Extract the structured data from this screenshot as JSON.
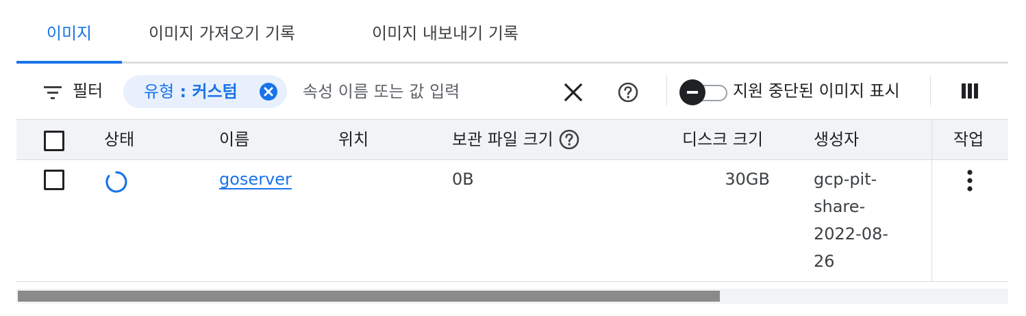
{
  "tabs": [
    {
      "label": "이미지",
      "active": true
    },
    {
      "label": "이미지 가져오기 기록",
      "active": false
    },
    {
      "label": "이미지 내보내기 기록",
      "active": false
    }
  ],
  "filterbar": {
    "filter_label": "필터",
    "chip": {
      "key": "유형",
      "separator": " : ",
      "value": "커스텀"
    },
    "input_placeholder": "속성 이름 또는 값 입력",
    "input_value": "",
    "toggle_label": "지원 중단된 이미지 표시",
    "icons": [
      "filter-icon",
      "chip-close-icon",
      "clear-icon",
      "help-icon",
      "column-display-icon"
    ]
  },
  "table": {
    "headers": {
      "status": "상태",
      "name": "이름",
      "location": "위치",
      "archive_size": "보관 파일 크기",
      "disk_size": "디스크 크기",
      "creator": "생성자",
      "actions": "작업"
    },
    "rows": [
      {
        "status_icon": "loading-spinner-icon",
        "name": "goserver",
        "location": "",
        "archive_size": "0B",
        "disk_size": "30GB",
        "creator_lines": [
          "gcp-pit-",
          "share-",
          "2022-08-",
          "26"
        ]
      }
    ]
  },
  "colors": {
    "accent": "#1a73e8",
    "chip_bg": "#e8f0fe",
    "header_bg": "#f1f3f4",
    "divider": "#dadce0",
    "scroll_thumb": "#8a8a8a"
  },
  "scrollbar": {
    "visible_fraction": 0.71
  }
}
